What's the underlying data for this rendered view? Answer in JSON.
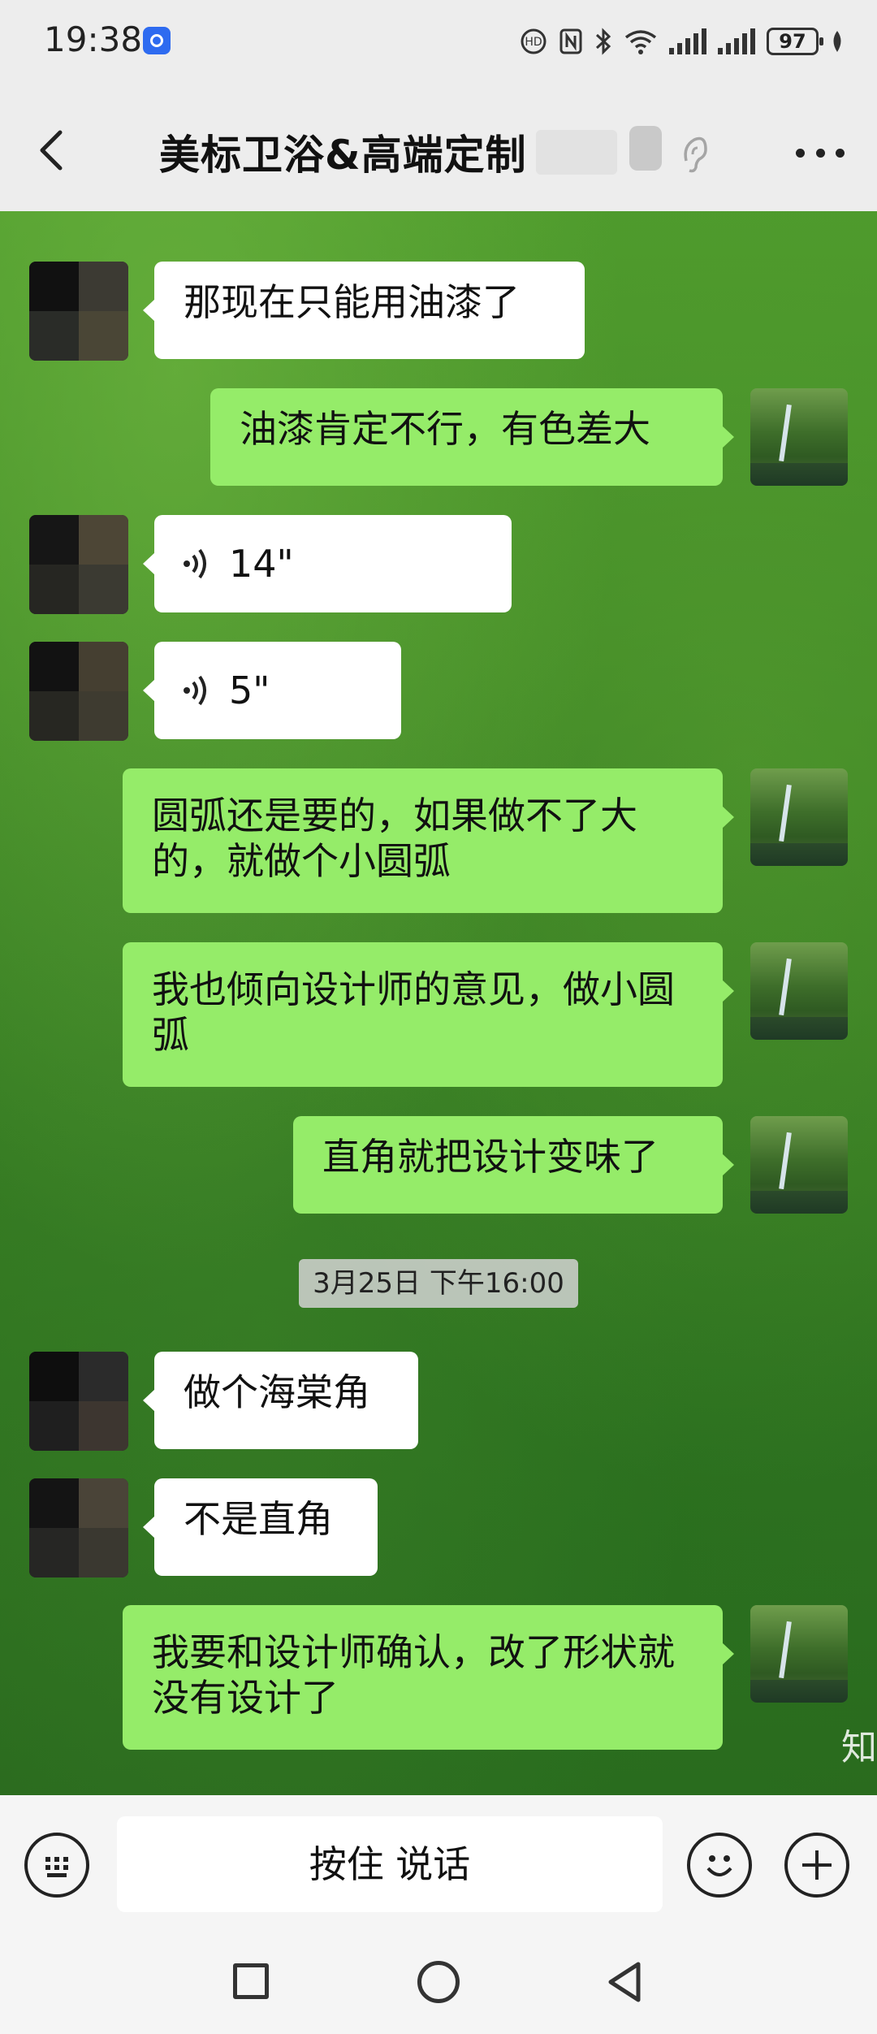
{
  "status_bar": {
    "time": "19:38",
    "battery": "97",
    "icons": [
      "app-notification-icon",
      "hd-call-icon",
      "nfc-icon",
      "bluetooth-icon",
      "wifi-icon",
      "signal-icon",
      "signal-icon",
      "battery-icon",
      "leaf-icon"
    ]
  },
  "header": {
    "title": "美标卫浴&高端定制",
    "back_icon": "chevron-left-icon",
    "more_icon": "more-dots-icon"
  },
  "messages": [
    {
      "side": "in",
      "type": "text",
      "text": "那现在只能用油漆了"
    },
    {
      "side": "out",
      "type": "text",
      "text": "油漆肯定不行，有色差大"
    },
    {
      "side": "in",
      "type": "voice",
      "text": "14\""
    },
    {
      "side": "in",
      "type": "voice",
      "text": "5\""
    },
    {
      "side": "out",
      "type": "text",
      "text": "圆弧还是要的，如果做不了大的，就做个小圆弧"
    },
    {
      "side": "out",
      "type": "text",
      "text": "我也倾向设计师的意见，做小圆弧"
    },
    {
      "side": "out",
      "type": "text",
      "text": "直角就把设计变味了"
    },
    {
      "type": "timestamp",
      "text": "3月25日 下午16:00"
    },
    {
      "side": "in",
      "type": "text",
      "text": "做个海棠角"
    },
    {
      "side": "in",
      "type": "text",
      "text": "不是直角"
    },
    {
      "side": "out",
      "type": "text",
      "text": "我要和设计师确认，改了形状就没有设计了"
    }
  ],
  "watermark": "知",
  "input_bar": {
    "hold_to_talk": "按住 说话",
    "keyboard_icon": "keyboard-icon",
    "emoji_icon": "emoji-icon",
    "plus_icon": "plus-icon"
  },
  "nav_bar": {
    "icons": [
      "recent-apps-icon",
      "home-icon",
      "back-icon"
    ]
  },
  "colors": {
    "incoming_bubble": "#ffffff",
    "outgoing_bubble": "#95ec69",
    "header_bg": "#ededed"
  }
}
